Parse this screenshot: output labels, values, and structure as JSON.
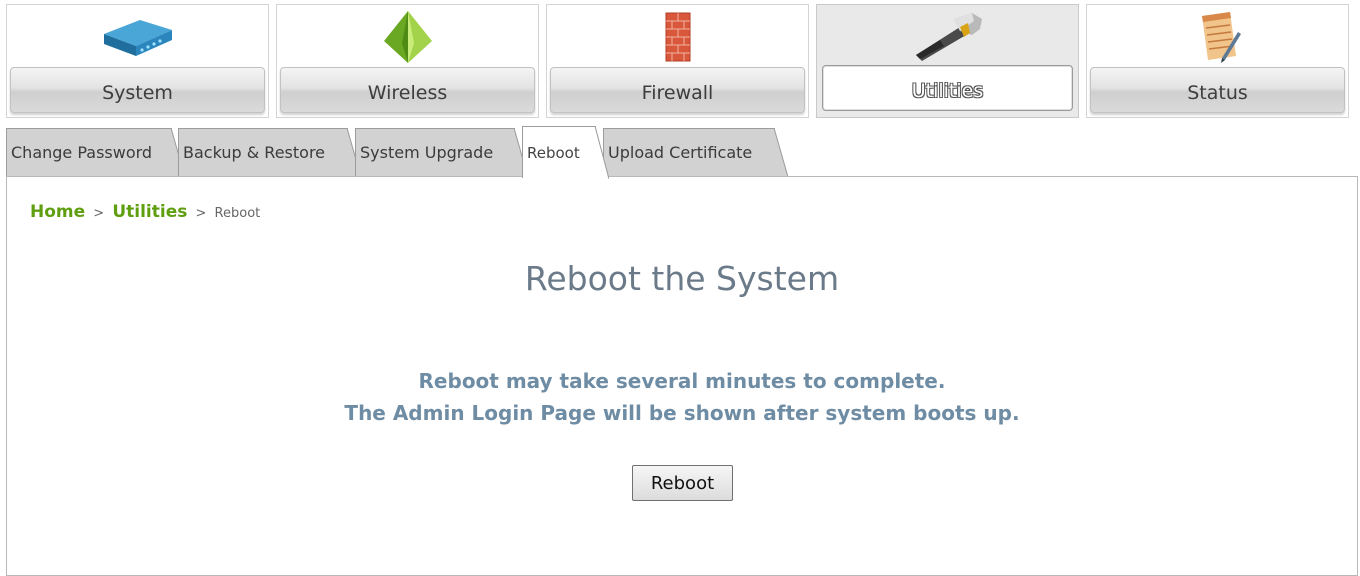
{
  "top_nav": {
    "items": [
      {
        "label": "System",
        "icon": "router-icon",
        "active": false
      },
      {
        "label": "Wireless",
        "icon": "pyramid-icon",
        "active": false
      },
      {
        "label": "Firewall",
        "icon": "firewall-icon",
        "active": false
      },
      {
        "label": "Utilities",
        "icon": "hammer-icon",
        "active": true
      },
      {
        "label": "Status",
        "icon": "notepad-icon",
        "active": false
      }
    ]
  },
  "sub_tabs": {
    "items": [
      {
        "label": "Change Password",
        "active": false
      },
      {
        "label": "Backup & Restore",
        "active": false
      },
      {
        "label": "System Upgrade",
        "active": false
      },
      {
        "label": "Reboot",
        "active": true
      },
      {
        "label": "Upload Certificate",
        "active": false
      }
    ]
  },
  "breadcrumb": {
    "home": "Home",
    "separator": ">",
    "section": "Utilities",
    "current": "Reboot"
  },
  "content": {
    "title": "Reboot the System",
    "message_line1": "Reboot may take several minutes to complete.",
    "message_line2": "The Admin Login Page will be shown after system boots up.",
    "reboot_button": "Reboot"
  },
  "colors": {
    "breadcrumb_link": "#5f9f0f",
    "title": "#6b7a89",
    "message": "#6e8ca4",
    "tab_inactive": "#d2d2d2"
  }
}
